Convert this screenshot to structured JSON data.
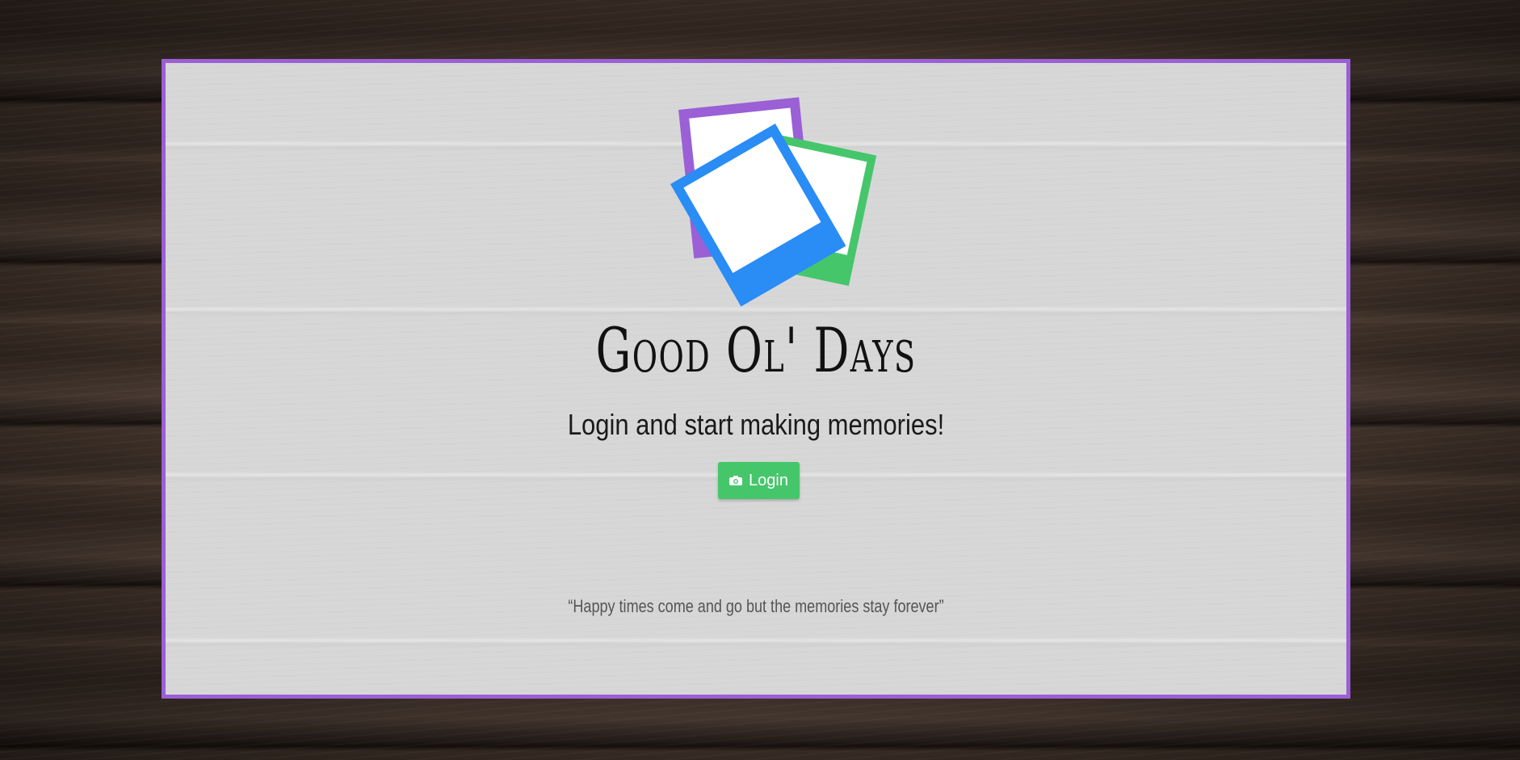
{
  "app": {
    "title": "Good Ol' Days",
    "tagline": "Login and start making memories!",
    "login_label": "Login",
    "quote": "“Happy times come and go but the memories stay forever”"
  },
  "icons": {
    "login_icon": "camera-icon",
    "logo": "stacked-photos-logo"
  },
  "colors": {
    "accent_purple": "#9b5fd6",
    "accent_green": "#46c66b",
    "accent_blue": "#2a8cf5",
    "card_background": "#d7d7d8"
  }
}
